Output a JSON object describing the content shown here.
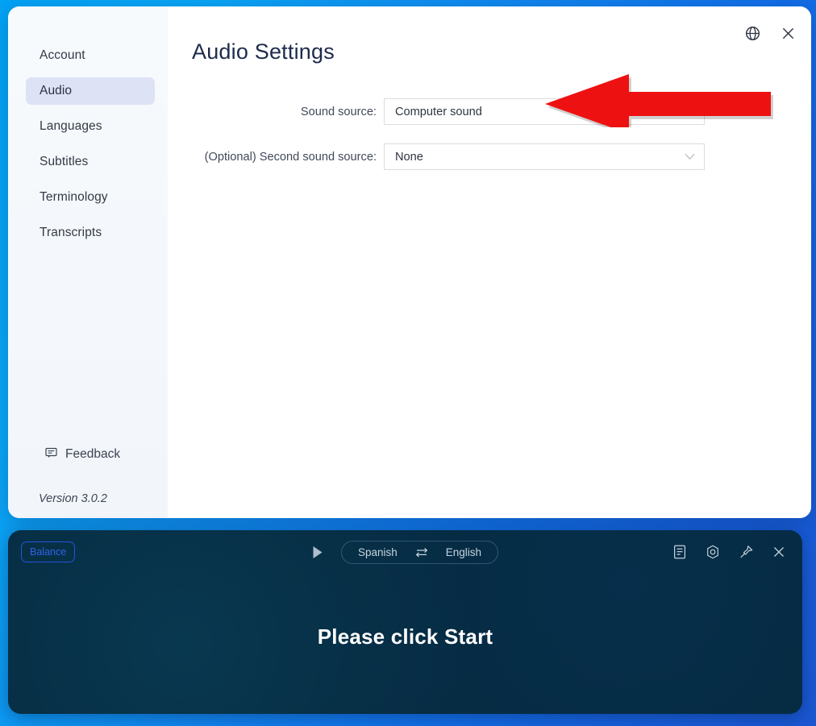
{
  "window": {
    "title": "Audio Settings",
    "controls": [
      {
        "name": "language-globe",
        "icon": "globe-icon"
      },
      {
        "name": "close-window",
        "icon": "close-icon"
      }
    ]
  },
  "sidebar": {
    "items": [
      {
        "label": "Account",
        "active": false
      },
      {
        "label": "Audio",
        "active": true
      },
      {
        "label": "Languages",
        "active": false
      },
      {
        "label": "Subtitles",
        "active": false
      },
      {
        "label": "Terminology",
        "active": false
      },
      {
        "label": "Transcripts",
        "active": false
      }
    ],
    "feedback_label": "Feedback",
    "version": "Version 3.0.2",
    "active_background": "#dde3f5"
  },
  "settings_form": {
    "rows": [
      {
        "label": "Sound source:",
        "value": "Computer sound",
        "has_chevron": false
      },
      {
        "label": "(Optional) Second sound source:",
        "value": "None",
        "has_chevron": true
      }
    ],
    "chevron_glyph": "∨"
  },
  "annotation": {
    "type": "arrow",
    "direction": "left",
    "color": "#ee1111",
    "points_at": "Sound source:"
  },
  "bottom_panel": {
    "balance_label": "Balance",
    "balance_color": "#2f63e8",
    "play_icon": "play-icon",
    "source_language": "Spanish",
    "target_language": "English",
    "swap_icon": "swap-arrows-icon",
    "message": "Please click Start",
    "right_icons": [
      {
        "name": "transcript-icon",
        "label": "Transcript"
      },
      {
        "name": "settings-gear-icon",
        "label": "Settings"
      },
      {
        "name": "pin-icon",
        "label": "Pin"
      },
      {
        "name": "close-icon",
        "label": "Close"
      }
    ],
    "background_color": "#062a40"
  },
  "desktop": {
    "background_gradient_start": "#03a3f5",
    "background_gradient_end": "#1a57d2"
  }
}
